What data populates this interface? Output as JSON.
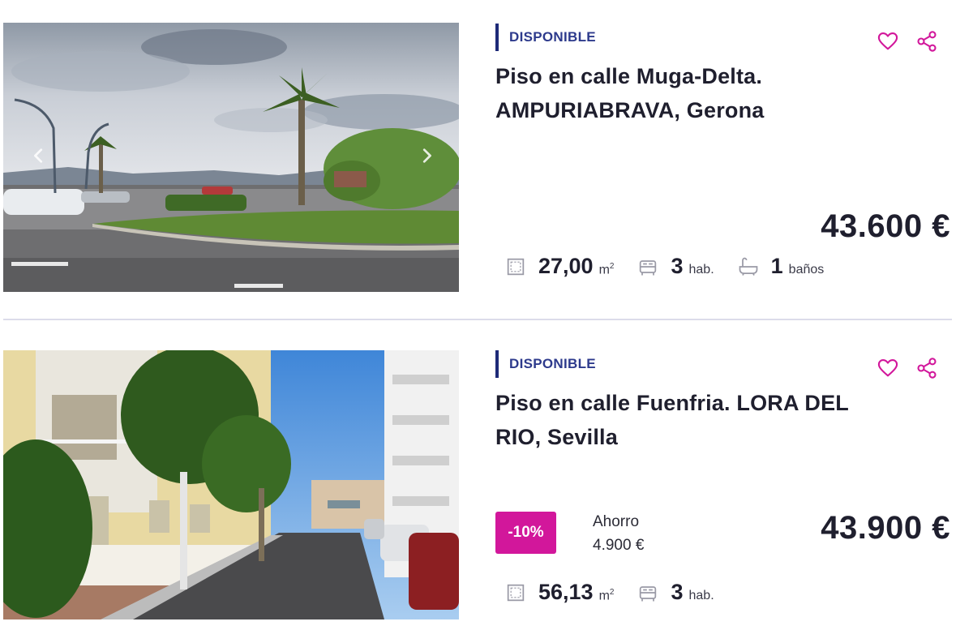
{
  "colors": {
    "accent_pink": "#d2179b",
    "status_navy": "#1e2a78",
    "text_dark": "#1f1f2e",
    "divider": "#dcdcea"
  },
  "listings": [
    {
      "status": "DISPONIBLE",
      "title": "Piso en calle Muga-Delta. AMPURIABRAVA, Gerona",
      "price": "43.600 €",
      "photo": "street-with-palm-tree-photo",
      "features": {
        "area_value": "27,00",
        "area_unit": "m",
        "area_unit_sup": "2",
        "rooms_value": "3",
        "rooms_unit": "hab.",
        "baths_value": "1",
        "baths_unit": "baños"
      },
      "icons": [
        "favorite-heart-icon",
        "share-icon",
        "area-icon",
        "bed-icon",
        "bath-icon",
        "chevron-left-icon",
        "chevron-right-icon"
      ]
    },
    {
      "status": "DISPONIBLE",
      "title": "Piso en calle Fuenfria. LORA DEL RIO, Sevilla",
      "price": "43.900 €",
      "photo": "residential-street-photo",
      "discount": "-10%",
      "savings_label": "Ahorro",
      "savings_value": "4.900 €",
      "features": {
        "area_value": "56,13",
        "area_unit": "m",
        "area_unit_sup": "2",
        "rooms_value": "3",
        "rooms_unit": "hab."
      },
      "icons": [
        "favorite-heart-icon",
        "share-icon",
        "area-icon",
        "bed-icon"
      ]
    }
  ]
}
